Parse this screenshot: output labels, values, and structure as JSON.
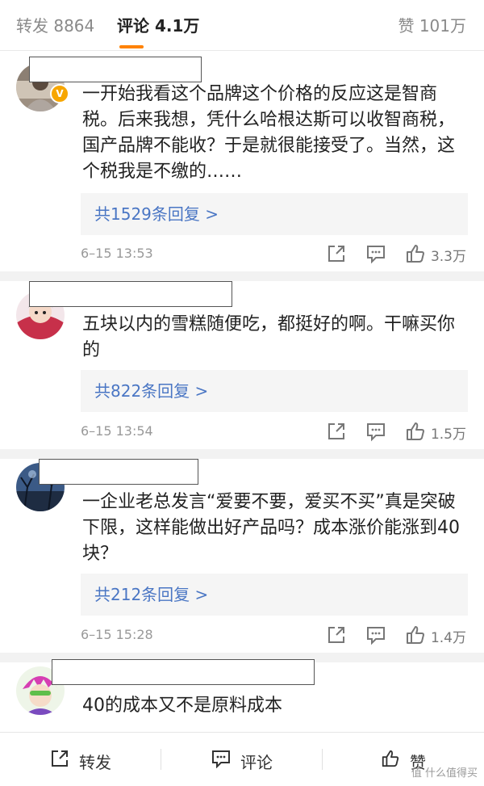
{
  "header": {
    "tab_repost": "转发 8864",
    "tab_comments": "评论 4.1万",
    "tab_likes": "赞 101万"
  },
  "comments": [
    {
      "text": "一开始我看这个品牌这个价格的反应这是智商税。后来我想，凭什么哈根达斯可以收智商税，国产品牌不能收？于是就很能接受了。当然，这个税我是不缴的……",
      "verified_badge": "V",
      "replies": "共1529条回复 >",
      "time": "6–15 13:53",
      "likes": "3.3万"
    },
    {
      "text": "五块以内的雪糕随便吃，都挺好的啊。干嘛买你的",
      "replies": "共822条回复 >",
      "time": "6–15 13:54",
      "likes": "1.5万"
    },
    {
      "text": "一企业老总发言“爱要不要，爱买不买”真是突破下限，这样能做出好产品吗？成本涨价能涨到40块？",
      "replies": "共212条回复 >",
      "time": "6–15 15:28",
      "likes": "1.4万"
    },
    {
      "text": "40的成本又不是原料成本"
    }
  ],
  "bottom_bar": {
    "repost": "转发",
    "comment": "评论",
    "like": "赞"
  },
  "watermark": "值 什么值得买",
  "icons": {
    "share": "share-icon",
    "comment": "comment-icon",
    "like": "thumbs-up-icon"
  },
  "colors": {
    "accent": "#ff8200",
    "link": "#4a76c4",
    "muted": "#999999"
  }
}
